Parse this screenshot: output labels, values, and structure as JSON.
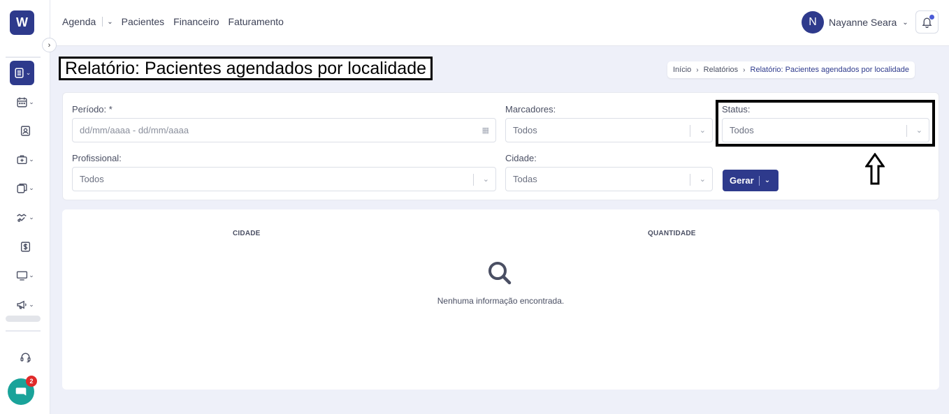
{
  "app": {
    "logo_text": "W"
  },
  "topnav": {
    "items": [
      "Agenda",
      "Pacientes",
      "Financeiro",
      "Faturamento"
    ]
  },
  "user": {
    "initial": "N",
    "name": "Nayanne Seara"
  },
  "notifications": {
    "has_unread": true
  },
  "chat": {
    "badge_count": "2"
  },
  "page": {
    "title": "Relatório: Pacientes agendados por localidade"
  },
  "breadcrumb": [
    "Início",
    "Relatórios",
    "Relatório: Pacientes agendados por localidade"
  ],
  "filters": {
    "periodo": {
      "label": "Período: *",
      "placeholder": "dd/mm/aaaa - dd/mm/aaaa"
    },
    "marcadores": {
      "label": "Marcadores:",
      "value": "Todos"
    },
    "status": {
      "label": "Status:",
      "value": "Todos"
    },
    "profissional": {
      "label": "Profissional:",
      "value": "Todos"
    },
    "cidade": {
      "label": "Cidade:",
      "value": "Todas"
    },
    "generate_label": "Gerar"
  },
  "results": {
    "columns": [
      "CIDADE",
      "QUANTIDADE"
    ],
    "empty_message": "Nenhuma informação encontrada."
  },
  "colors": {
    "primary": "#2e3a8c",
    "background": "#eef0f9",
    "chat": "#1aa39a",
    "badge": "#e02a2a"
  },
  "sidebar_icons": [
    "report-icon",
    "calendar-icon",
    "patient-card-icon",
    "medical-case-icon",
    "documents-icon",
    "handshake-icon",
    "dollar-icon",
    "monitor-icon",
    "megaphone-icon",
    "headset-icon"
  ]
}
